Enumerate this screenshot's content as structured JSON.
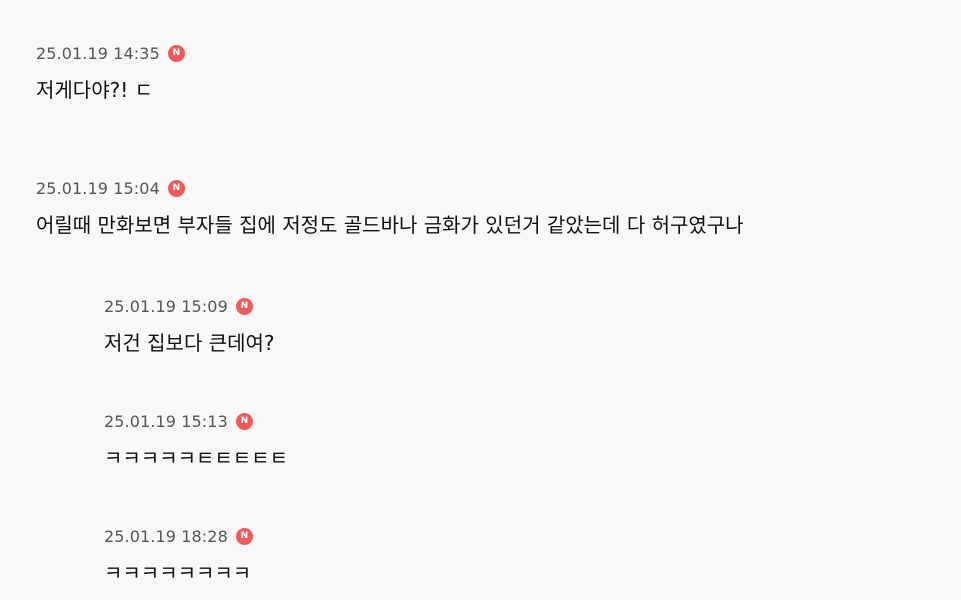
{
  "badge": {
    "label": "N",
    "color": "#f25a5a"
  },
  "comments": [
    {
      "time": "25.01.19 14:35",
      "text": "저게다야?! ㄷ",
      "reply": false
    },
    {
      "time": "25.01.19 15:04",
      "text": "어릴때 만화보면 부자들 집에 저정도 골드바나 금화가 있던거 같았는데 다 허구였구나",
      "reply": false
    },
    {
      "time": "25.01.19 15:09",
      "text": "저건 집보다 큰데여?",
      "reply": true
    },
    {
      "time": "25.01.19 15:13",
      "text": "ㅋㅋㅋㅋㅋㅌㅌㅌㅌㅌ",
      "reply": true
    },
    {
      "time": "25.01.19 18:28",
      "text": "ㅋㅋㅋㅋㅋㅋㅋㅋ",
      "reply": true
    }
  ]
}
